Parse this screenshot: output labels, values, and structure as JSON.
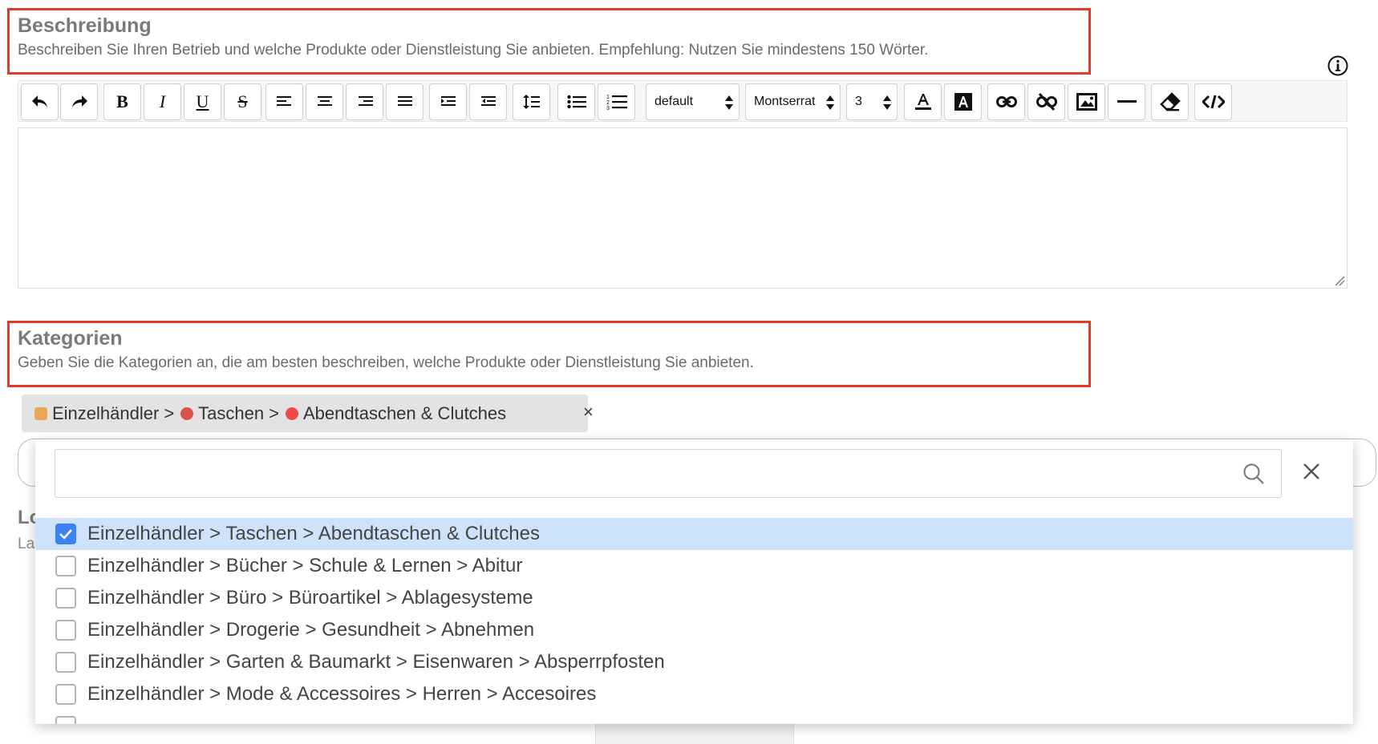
{
  "beschreibung": {
    "title": "Beschreibung",
    "description": "Beschreiben Sie Ihren Betrieb und welche Produkte oder Dienstleistung Sie anbieten. Empfehlung: Nutzen Sie mindestens 150 Wörter."
  },
  "toolbar": {
    "style_select": "default",
    "font_select": "Montserrat",
    "size_select": "3",
    "bold": "B",
    "italic": "I",
    "underline": "U",
    "strike": "S"
  },
  "kategorien": {
    "title": "Kategorien",
    "description": "Geben Sie die Kategorien an, die am besten beschreiben, welche Produkte oder Dienstleistung Sie anbieten."
  },
  "selected_tag": {
    "part1": "Einzelhändler",
    "part2": "Taschen",
    "part3": "Abendtaschen & Clutches",
    "separator": ">",
    "close": "×"
  },
  "behind": {
    "lo": "Lo",
    "la": "La"
  },
  "dropdown": {
    "search_value": "",
    "options": [
      {
        "label": "Einzelhändler > Taschen > Abendtaschen & Clutches",
        "checked": true
      },
      {
        "label": "Einzelhändler > Bücher > Schule & Lernen > Abitur",
        "checked": false
      },
      {
        "label": "Einzelhändler > Büro > Büroartikel > Ablagesysteme",
        "checked": false
      },
      {
        "label": "Einzelhändler > Drogerie > Gesundheit > Abnehmen",
        "checked": false
      },
      {
        "label": "Einzelhändler > Garten & Baumarkt > Eisenwaren > Absperrpfosten",
        "checked": false
      },
      {
        "label": "Einzelhändler > Mode & Accessoires > Herren > Accesoires",
        "checked": false
      }
    ]
  },
  "colors": {
    "highlight": "#e23b2a",
    "accent": "#3b82f6",
    "selected_row": "#cfe2fb"
  }
}
